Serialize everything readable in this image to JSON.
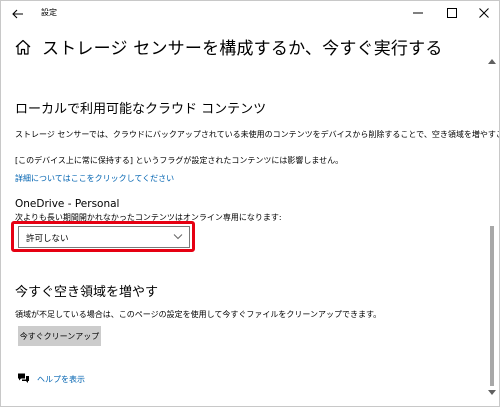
{
  "window": {
    "title": "設定"
  },
  "page": {
    "title": "ストレージ センサーを構成するか、今すぐ実行する"
  },
  "cloud": {
    "heading": "ローカルで利用可能なクラウド コンテンツ",
    "desc": "ストレージ センサーでは、クラウドにバックアップされている未使用のコンテンツをデバイスから削除することで、空き領域を増やすことができます。",
    "note": "[このデバイス上に常に保持する] というフラグが設定されたコンテンツには影響しません。",
    "link": "詳細についてはここをクリックしてください"
  },
  "onedrive": {
    "heading": "OneDrive - Personal",
    "label": "次よりも長い期間開かれなかったコンテンツはオンライン専用になります:",
    "selected": "許可しない"
  },
  "free_space": {
    "heading": "今すぐ空き領域を増やす",
    "desc": "領域が不足している場合は、このページの設定を使用して今すぐファイルをクリーンアップできます。",
    "button": "今すぐクリーンアップ"
  },
  "help": {
    "link": "ヘルプを表示"
  },
  "colors": {
    "link": "#0063b1",
    "highlight": "#e60012",
    "button_bg": "#cccccc"
  },
  "icons": [
    "back-arrow-icon",
    "minimize-icon",
    "maximize-icon",
    "close-icon",
    "home-icon",
    "chevron-down-icon",
    "help-chat-icon",
    "scroll-up-icon",
    "scroll-down-icon"
  ]
}
